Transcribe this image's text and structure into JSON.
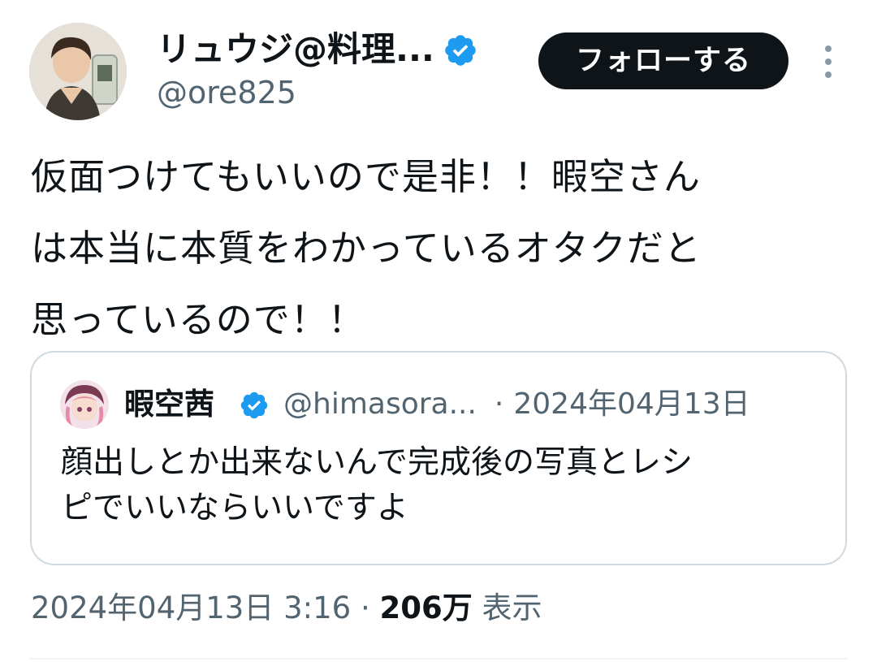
{
  "author": {
    "display_name": "リュウジ@料理...",
    "handle": "@ore825",
    "verified_icon": "verified-badge-icon",
    "follow_label": "フォローする"
  },
  "tweet": {
    "text": "仮面つけてもいいので是非！！暇空さん\nは本当に本質をわかっているオタクだと\n思っているので！！",
    "timestamp": "2024年04月13日 3:16",
    "separator": "·",
    "views_count": "206万",
    "views_label": "表示"
  },
  "quote": {
    "display_name": "暇空茜",
    "handle": "@himasora...",
    "separator": "·",
    "date": "2024年04月13日",
    "text": "顔出しとか出来ないんで完成後の写真とレシ\nピでいいならいいですよ"
  },
  "colors": {
    "text_primary": "#0f1419",
    "text_secondary": "#536471",
    "verified_blue": "#1d9bf0",
    "button_bg": "#0f1419",
    "border": "#cfd9de"
  },
  "icons": [
    "verified-badge-icon",
    "more-options-icon"
  ]
}
